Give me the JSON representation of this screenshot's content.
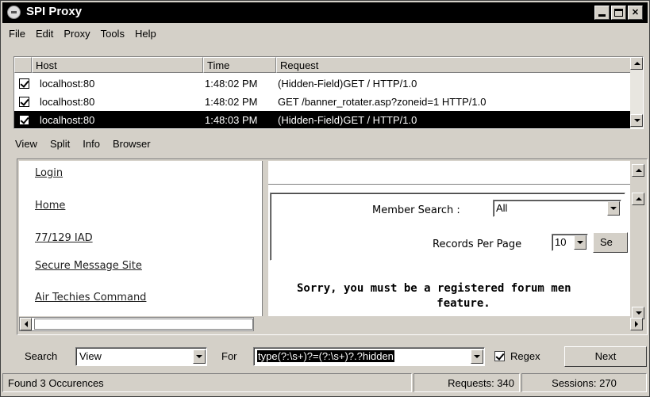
{
  "window": {
    "title": "SPI Proxy"
  },
  "menu": [
    "File",
    "Edit",
    "Proxy",
    "Tools",
    "Help"
  ],
  "list": {
    "columns": [
      "Host",
      "Time",
      "Request"
    ],
    "rows": [
      {
        "host": "localhost:80",
        "time": "1:48:02 PM",
        "request": "(Hidden-Field)GET / HTTP/1.0",
        "checked": true,
        "selected": false
      },
      {
        "host": "localhost:80",
        "time": "1:48:02 PM",
        "request": "GET /banner_rotater.asp?zoneid=1 HTTP/1.0",
        "checked": true,
        "selected": false
      },
      {
        "host": "localhost:80",
        "time": "1:48:03 PM",
        "request": "(Hidden-Field)GET / HTTP/1.0",
        "checked": true,
        "selected": true
      }
    ]
  },
  "subtoolbar": [
    "View",
    "Split",
    "Info",
    "Browser"
  ],
  "browser": {
    "left_links": [
      "Login",
      "Home",
      "77/129 IAD",
      "Secure Message Site",
      "Air Techies Command"
    ],
    "member_search_label": "Member Search :",
    "member_search_value": "All",
    "records_label": "Records Per Page",
    "records_value": "10",
    "search_button": "Se",
    "sorry_line1": "Sorry, you must be a registered forum men",
    "sorry_line2": "feature."
  },
  "search": {
    "search_label": "Search",
    "search_value": "View",
    "for_label": "For",
    "for_value": "type(?:\\s+)?=(?:\\s+)?.?hidden",
    "regex_label": "Regex",
    "regex_checked": true,
    "next_button": "Next"
  },
  "status": {
    "found": "Found 3 Occurences",
    "requests": "Requests: 340",
    "sessions": "Sessions: 270"
  },
  "colors": {
    "face": "#d4d0c8",
    "titlebar": "#000000",
    "selection": "#000000"
  }
}
